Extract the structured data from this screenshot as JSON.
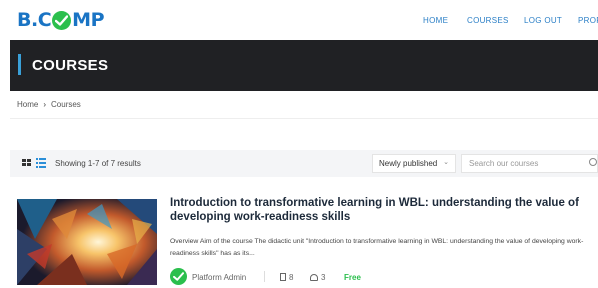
{
  "header": {
    "logo_text_left": "B.C",
    "logo_text_right": "MP",
    "nav": [
      {
        "label": "HOME"
      },
      {
        "label": "COURSES"
      },
      {
        "label": "LOG OUT"
      },
      {
        "label": "PROF"
      }
    ]
  },
  "banner": {
    "title": "COURSES"
  },
  "breadcrumb": {
    "home": "Home",
    "separator": "›",
    "current": "Courses"
  },
  "toolbar": {
    "showing": "Showing 1-7 of 7 results",
    "sort_value": "Newly published",
    "search_placeholder": "Search our courses"
  },
  "course": {
    "title": "Introduction to transformative learning in WBL: understanding the value of developing work-readiness skills",
    "description": "Overview Aim of the course The didactic unit \"Introduction to transformative learning in WBL: understanding the value of developing work-readiness skills\" has as its...",
    "author": "Platform Admin",
    "lessons": "8",
    "students": "3",
    "price": "Free"
  },
  "colors": {
    "brand_blue": "#1a74c4",
    "brand_green": "#2bbf4d",
    "banner_bg": "#202124",
    "accent": "#3aa0d8"
  }
}
